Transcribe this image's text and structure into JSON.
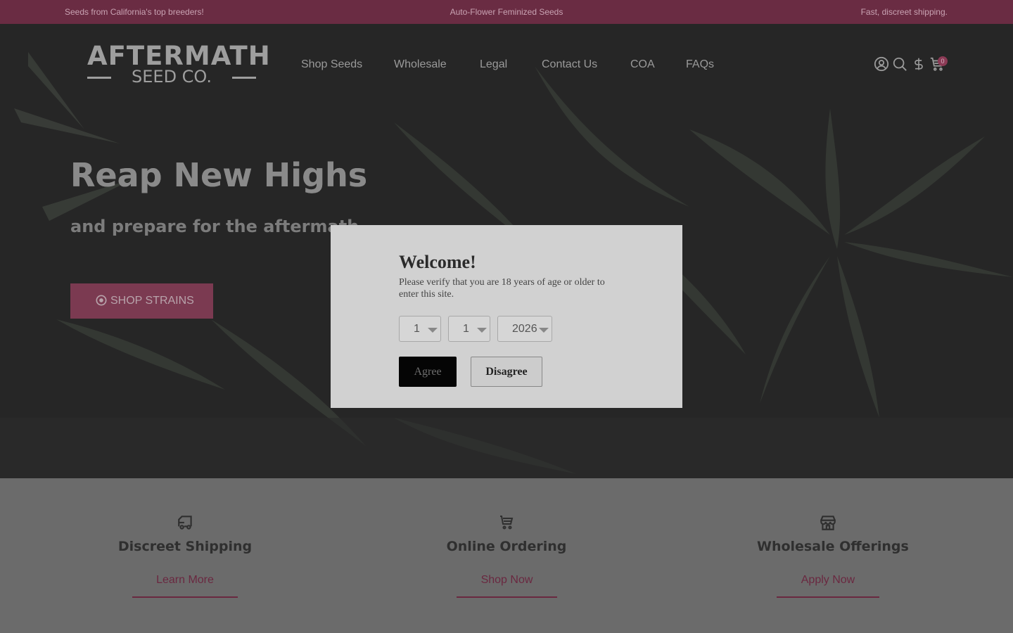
{
  "topbar": {
    "left": "Seeds from California's top breeders!",
    "center": "Auto-Flower Feminized Seeds",
    "right": "Fast, discreet shipping."
  },
  "logo": {
    "line1": "AFTERMATH",
    "line2": "SEED CO."
  },
  "nav": [
    "Shop Seeds",
    "Wholesale",
    "Legal",
    "Contact Us",
    "COA",
    "FAQs"
  ],
  "header_icons": [
    "account-icon",
    "search-icon",
    "currency-icon",
    "cart-icon"
  ],
  "cart_count": "0",
  "hero": {
    "title": "Reap New Highs",
    "subtitle": "and prepare for the aftermath.",
    "button_label": "SHOP STRAINS"
  },
  "features": [
    {
      "icon": "delivery-truck-icon",
      "title": "Discreet Shipping",
      "link": "Learn More"
    },
    {
      "icon": "cart-icon",
      "title": "Online Ordering",
      "link": "Shop Now"
    },
    {
      "icon": "storefront-icon",
      "title": "Wholesale Offerings",
      "link": "Apply Now"
    }
  ],
  "age_gate": {
    "title": "Welcome!",
    "message": "Please verify that you are 18 years of age or older to enter this site.",
    "month": "1",
    "day": "1",
    "year": "2026",
    "agree_label": "Agree",
    "disagree_label": "Disagree"
  },
  "colors": {
    "brand": "#6a2c43",
    "accent": "#7b3a51",
    "overlay_text": "#9a9a9a"
  }
}
